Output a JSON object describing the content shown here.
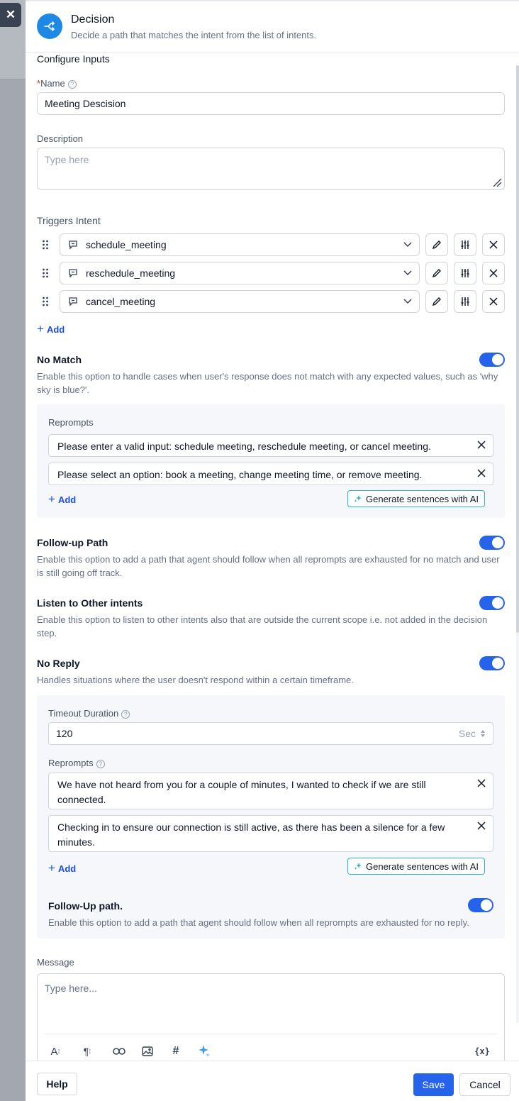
{
  "panel": {
    "title": "Decision",
    "description": "Decide a path that matches the intent from the list of intents."
  },
  "configure": {
    "heading": "Configure Inputs"
  },
  "name_field": {
    "required_mark": "*",
    "label": "Name",
    "value": "Meeting Descision"
  },
  "description_field": {
    "label": "Description",
    "placeholder": "Type here"
  },
  "triggers": {
    "label": "Triggers Intent",
    "items": [
      {
        "label": "schedule_meeting"
      },
      {
        "label": "reschedule_meeting"
      },
      {
        "label": "cancel_meeting"
      }
    ],
    "add_label": "Add"
  },
  "no_match": {
    "title": "No Match",
    "description": "Enable this option to handle cases when user's response does not match with any expected values, such as 'why sky is blue?'.",
    "enabled": true,
    "reprompts_label": "Reprompts",
    "reprompts": [
      "Please enter a valid input: schedule meeting, reschedule meeting, or cancel meeting.",
      "Please select an option: book a meeting, change meeting time, or remove meeting."
    ],
    "add_label": "Add",
    "ai_label": "Generate sentences with AI"
  },
  "follow_up": {
    "title": "Follow-up Path",
    "description": "Enable this option to add a path that agent should follow when all reprompts are exhausted for no match and user is still going off track.",
    "enabled": true
  },
  "listen_other": {
    "title": "Listen to Other intents",
    "description": "Enable this option to listen to other intents also that are outside the current scope i.e. not added in the decision step.",
    "enabled": true
  },
  "no_reply": {
    "title": "No Reply",
    "description": "Handles situations where the user doesn't respond within a certain timeframe.",
    "enabled": true,
    "timeout_label": "Timeout Duration",
    "timeout_value": "120",
    "timeout_unit": "Sec",
    "reprompts_label": "Reprompts",
    "reprompts": [
      "We have not heard from you for a couple of minutes, I wanted to check if we are still connected.",
      "Checking in to ensure our connection is still active, as there has been a silence for a few minutes."
    ],
    "add_label": "Add",
    "ai_label": "Generate sentences with AI",
    "follow_up_title": "Follow-Up path.",
    "follow_up_description": "Enable this option to add a path that agent should follow when all reprompts are exhausted for no reply.",
    "follow_up_enabled": true
  },
  "message": {
    "label": "Message",
    "placeholder": "Type here..."
  },
  "footer": {
    "help_label": "Help",
    "save_label": "Save",
    "cancel_label": "Cancel"
  },
  "colors": {
    "primary": "#2563eb",
    "brand_icon": "#1e88e5",
    "ai_border": "#29b6c6"
  }
}
